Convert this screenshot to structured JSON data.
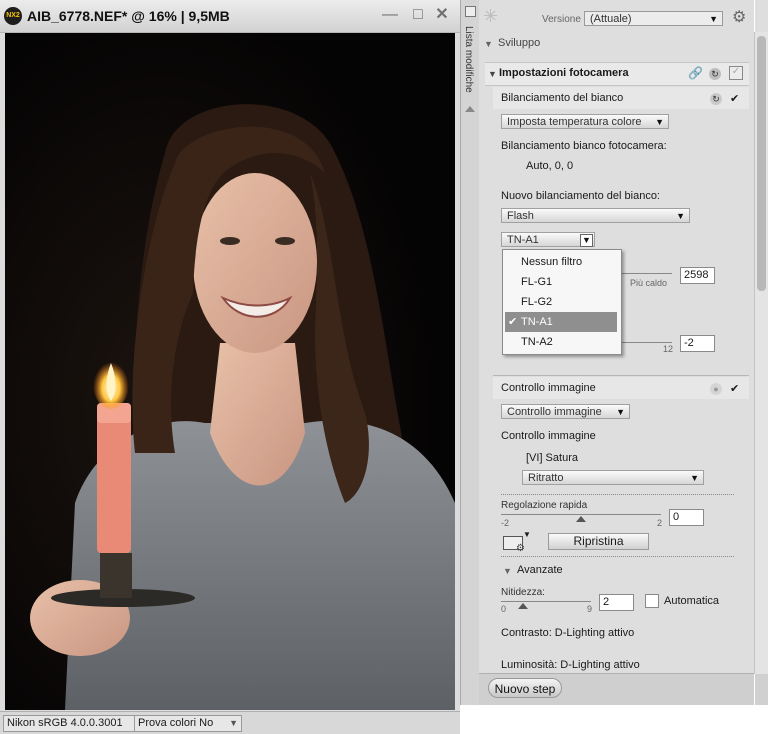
{
  "image_window": {
    "title": "AIB_6778.NEF* @ 16% | 9,5MB",
    "app_badge": "NX2",
    "status_profile": "Nikon sRGB 4.0.0.3001",
    "status_proof": "Prova colori No"
  },
  "side_tab": {
    "label": "Lista modifiche"
  },
  "panel": {
    "version_label": "Versione",
    "version_value": "(Attuale)",
    "develop_title": "Sviluppo",
    "camera_settings_title": "Impostazioni fotocamera",
    "wb": {
      "title": "Bilanciamento del bianco",
      "mode_dropdown": "Imposta temperatura colore",
      "camera_wb_label": "Bilanciamento bianco fotocamera:",
      "camera_wb_value": "Auto, 0, 0",
      "new_wb_label": "Nuovo bilanciamento del bianco:",
      "new_wb_value": "Flash",
      "filter_value": "TN-A1",
      "warmer_label": "Più caldo",
      "temp_value": "2598",
      "tint_max": "12",
      "tint_value": "-2"
    },
    "filter_menu": {
      "items": [
        "Nessun filtro",
        "FL-G1",
        "FL-G2",
        "TN-A1",
        "TN-A2"
      ],
      "selected": "TN-A1"
    },
    "picture_control": {
      "title": "Controllo immagine",
      "dropdown": "Controllo immagine",
      "label": "Controllo immagine",
      "current": "[VI] Satura",
      "preset": "Ritratto",
      "quick_adjust_label": "Regolazione rapida",
      "quick_min": "-2",
      "quick_max": "2",
      "quick_value": "0",
      "reset_button": "Ripristina",
      "advanced_title": "Avanzate",
      "sharpness_label": "Nitidezza:",
      "sharp_min": "0",
      "sharp_max": "9",
      "sharp_value": "2",
      "auto_label": "Automatica",
      "contrast_text": "Contrasto: D-Lighting attivo",
      "brightness_text": "Luminosità: D-Lighting attivo"
    },
    "new_step_button": "Nuovo step"
  }
}
